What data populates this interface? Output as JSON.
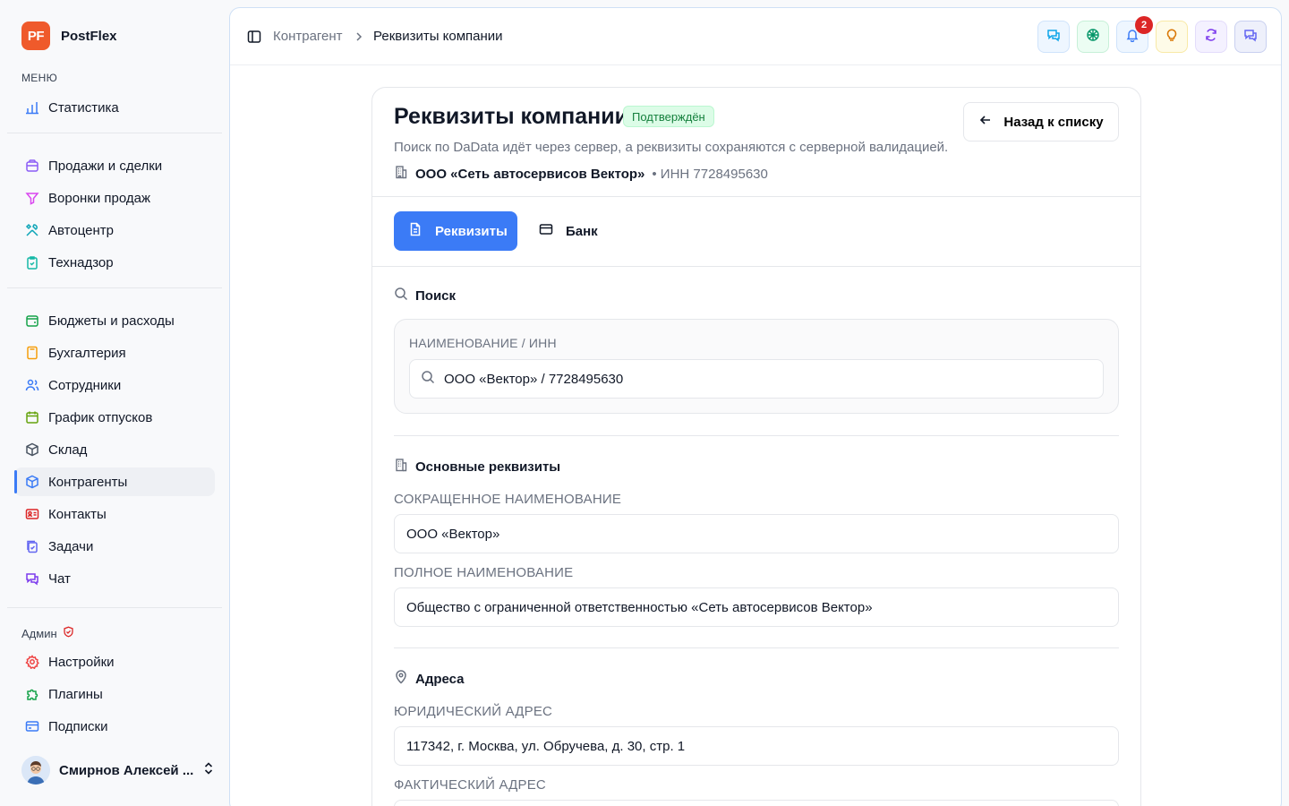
{
  "brand": {
    "logo_text": "PF",
    "name": "PostFlex"
  },
  "sidebar": {
    "menu_label": "МЕНЮ",
    "items": [
      {
        "label": "Статистика",
        "icon": "bar-chart-icon"
      },
      {
        "label": "Продажи и сделки",
        "icon": "briefcase-icon"
      },
      {
        "label": "Воронки продаж",
        "icon": "funnel-icon"
      },
      {
        "label": "Автоцентр",
        "icon": "wrench-icon"
      },
      {
        "label": "Технадзор",
        "icon": "clipboard-check-icon"
      },
      {
        "label": "Бюджеты и расходы",
        "icon": "wallet-icon"
      },
      {
        "label": "Бухгалтерия",
        "icon": "calculator-icon"
      },
      {
        "label": "Сотрудники",
        "icon": "users-icon"
      },
      {
        "label": "График отпусков",
        "icon": "calendar-icon"
      },
      {
        "label": "Склад",
        "icon": "box-icon"
      },
      {
        "label": "Контрагенты",
        "icon": "cube-icon",
        "active": true
      },
      {
        "label": "Контакты",
        "icon": "contact-card-icon"
      },
      {
        "label": "Задачи",
        "icon": "tasks-icon"
      },
      {
        "label": "Чат",
        "icon": "chat-icon"
      }
    ],
    "admin_label": "Админ",
    "admin_items": [
      {
        "label": "Настройки",
        "icon": "gear-icon"
      },
      {
        "label": "Плагины",
        "icon": "puzzle-icon"
      },
      {
        "label": "Подписки",
        "icon": "credit-card-icon"
      }
    ],
    "user_name": "Смирнов Алексей ..."
  },
  "topbar": {
    "breadcrumb_parent": "Контрагент",
    "breadcrumb_current": "Реквизиты компании",
    "notification_count": "2"
  },
  "page": {
    "title": "Реквизиты компании",
    "status": "Подтверждён",
    "subtitle": "Поиск по DaData идёт через сервер, а реквизиты сохраняются с серверной валидацией.",
    "company_name": "ООО «Сеть автосервисов Вектор»",
    "company_inn": "• ИНН 7728495630",
    "back_label": "Назад к списку"
  },
  "tabs": {
    "details": "Реквизиты",
    "bank": "Банк"
  },
  "search": {
    "section_title": "Поиск",
    "field_label": "НАИМЕНОВАНИЕ / ИНН",
    "value": "ООО «Вектор» / 7728495630"
  },
  "main_details": {
    "section_title": "Основные реквизиты",
    "short_name_label": "СОКРАЩЕННОЕ НАИМЕНОВАНИЕ",
    "short_name_value": "ООО «Вектор»",
    "full_name_label": "ПОЛНОЕ НАИМЕНОВАНИЕ",
    "full_name_value": "Общество с ограниченной ответственностью «Сеть автосервисов Вектор»"
  },
  "addresses": {
    "section_title": "Адреса",
    "legal_label": "ЮРИДИЧЕСКИЙ АДРЕС",
    "legal_value": "117342, г. Москва, ул. Обручева, д. 30, стр. 1",
    "actual_label": "ФАКТИЧЕСКИЙ АДРЕС"
  },
  "colors": {
    "accent": "#3b7bf6",
    "brand": "#ef5a2b",
    "success": "#15803d",
    "danger": "#dc2626"
  }
}
